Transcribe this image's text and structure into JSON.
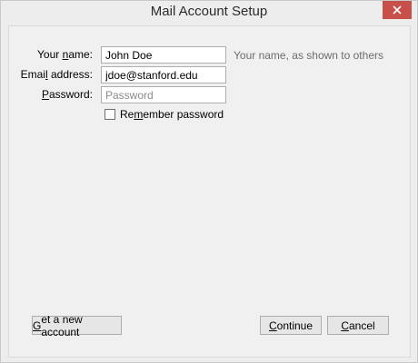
{
  "window": {
    "title": "Mail Account Setup"
  },
  "form": {
    "name": {
      "label_pre": "Your ",
      "label_key": "n",
      "label_post": "ame:",
      "value": "John Doe",
      "hint": "Your name, as shown to others"
    },
    "email": {
      "label_pre": "Emai",
      "label_key": "l",
      "label_post": " address:",
      "value": "jdoe@stanford.edu"
    },
    "password": {
      "label_pre": "",
      "label_key": "P",
      "label_post": "assword:",
      "value": "",
      "placeholder": "Password"
    },
    "remember": {
      "label_pre": "Re",
      "label_key": "m",
      "label_post": "ember password",
      "checked": false
    }
  },
  "buttons": {
    "get_new": {
      "label_pre": "",
      "label_key": "G",
      "label_post": "et a new account"
    },
    "continue": {
      "label_pre": "",
      "label_key": "C",
      "label_post": "ontinue"
    },
    "cancel": {
      "label_pre": "",
      "label_key": "C",
      "label_post": "ancel"
    }
  },
  "colors": {
    "close_button": "#c7504a",
    "window_bg": "#ededed",
    "content_bg": "#f0f0f0"
  },
  "icons": {
    "close": "close-icon"
  }
}
